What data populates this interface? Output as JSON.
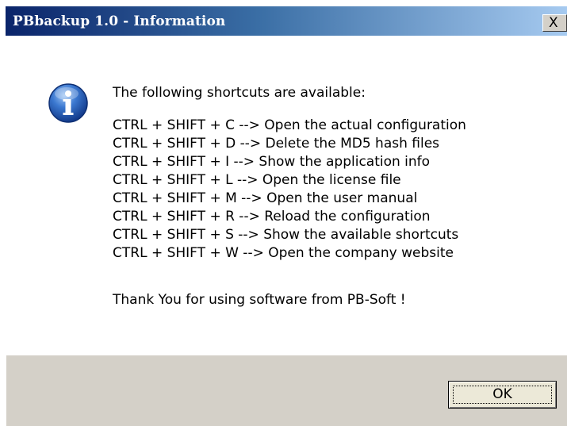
{
  "window": {
    "title": "PBbackup 1.0 - Information",
    "close_glyph": "X"
  },
  "message": {
    "icon": "information-icon",
    "intro": "The following shortcuts are available:",
    "shortcuts": [
      "CTRL + SHIFT + C  --> Open the actual configuration",
      "CTRL + SHIFT + D  --> Delete the MD5 hash files",
      "CTRL + SHIFT + I   --> Show the application info",
      "CTRL + SHIFT + L   --> Open the license file",
      "CTRL + SHIFT + M  --> Open the user manual",
      "CTRL + SHIFT + R  --> Reload the configuration",
      "CTRL + SHIFT + S  --> Show the available shortcuts",
      "CTRL + SHIFT + W --> Open the company website"
    ],
    "footer": "Thank You for using software from PB-Soft !"
  },
  "buttons": {
    "ok_label": "OK"
  },
  "colors": {
    "title_gradient_start": "#0a246a",
    "title_gradient_end": "#a6caf0",
    "dialog_face": "#d4d0c8",
    "icon_blue": "#2a5fb8"
  }
}
